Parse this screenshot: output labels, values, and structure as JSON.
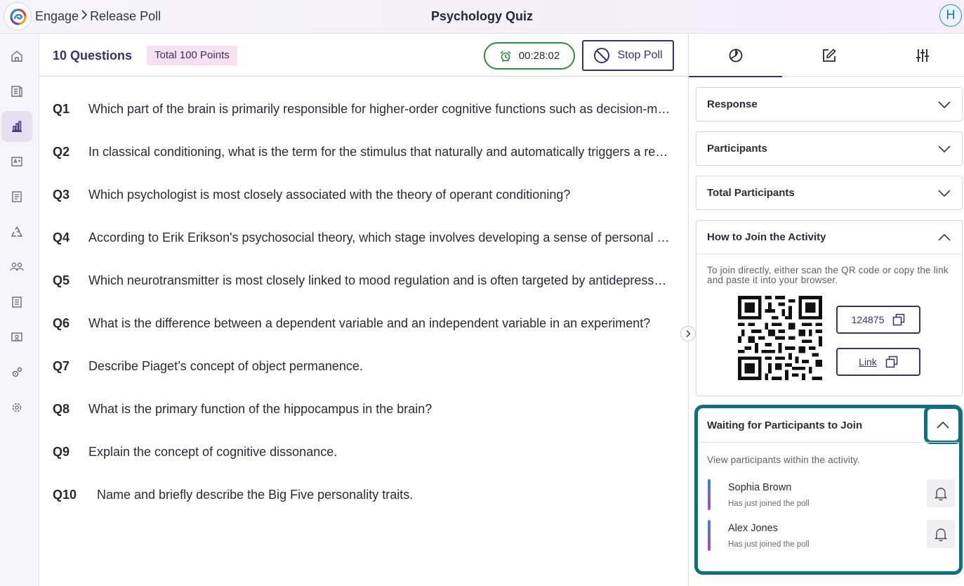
{
  "breadcrumb": {
    "root": "Engage",
    "current": "Release Poll"
  },
  "page_title": "Psychology Quiz",
  "user": {
    "initial": "H"
  },
  "sidebar": {
    "items": [
      {
        "icon": "home-icon"
      },
      {
        "icon": "content-icon"
      },
      {
        "icon": "analytics-icon",
        "active": true
      },
      {
        "icon": "grades-icon"
      },
      {
        "icon": "reports-icon"
      },
      {
        "icon": "recycle-icon"
      },
      {
        "icon": "users-icon"
      },
      {
        "icon": "list-icon"
      },
      {
        "icon": "classroom-icon"
      },
      {
        "icon": "integrations-icon"
      },
      {
        "icon": "settings-icon"
      }
    ]
  },
  "main": {
    "question_count": "10 Questions",
    "points_badge": "Total 100 Points",
    "timer": "00:28:02",
    "stop_label": "Stop Poll",
    "questions": [
      {
        "num": "Q1",
        "text": "Which part of the brain is primarily responsible for higher-order cognitive functions such as decision-making?"
      },
      {
        "num": "Q2",
        "text": "In classical conditioning, what is the term for the stimulus that naturally and automatically triggers a response?"
      },
      {
        "num": "Q3",
        "text": "Which psychologist is most closely associated with the theory of operant conditioning?"
      },
      {
        "num": "Q4",
        "text": "According to Erik Erikson's psychosocial theory, which stage involves developing a sense of personal identity?"
      },
      {
        "num": "Q5",
        "text": "Which neurotransmitter is most closely linked to mood regulation and is often targeted by antidepressants?"
      },
      {
        "num": "Q6",
        "text": "What is the difference between a dependent variable and an independent variable in an experiment?"
      },
      {
        "num": "Q7",
        "text": "Describe Piaget’s concept of object permanence."
      },
      {
        "num": "Q8",
        "text": "What is the primary function of the hippocampus in the brain?"
      },
      {
        "num": "Q9",
        "text": "Explain the concept of cognitive dissonance."
      },
      {
        "num": "Q10",
        "text": "Name and briefly describe the Big Five personality traits."
      }
    ]
  },
  "panel": {
    "tabs": [
      {
        "icon": "pie-chart-icon",
        "active": true
      },
      {
        "icon": "edit-icon"
      },
      {
        "icon": "sliders-icon"
      }
    ],
    "response_title": "Response",
    "participants_title": "Participants",
    "total_participants_title": "Total Participants",
    "join": {
      "title": "How to Join the Activity",
      "hint": "To join directly, either scan the QR code or copy the link and paste it into your browser.",
      "code": "124875",
      "link_label": "Link"
    },
    "waiting": {
      "title": "Waiting for Participants to Join",
      "hint": "View participants within the activity.",
      "participants": [
        {
          "name": "Sophia Brown",
          "status": "Has just joined the poll"
        },
        {
          "name": "Alex Jones",
          "status": "Has just joined the poll"
        }
      ]
    }
  },
  "colors": {
    "accent": "#3d2f6e",
    "timer_border": "#2e8b3c",
    "highlight": "#0f6e80",
    "badge_bg": "#f6e0f2"
  }
}
